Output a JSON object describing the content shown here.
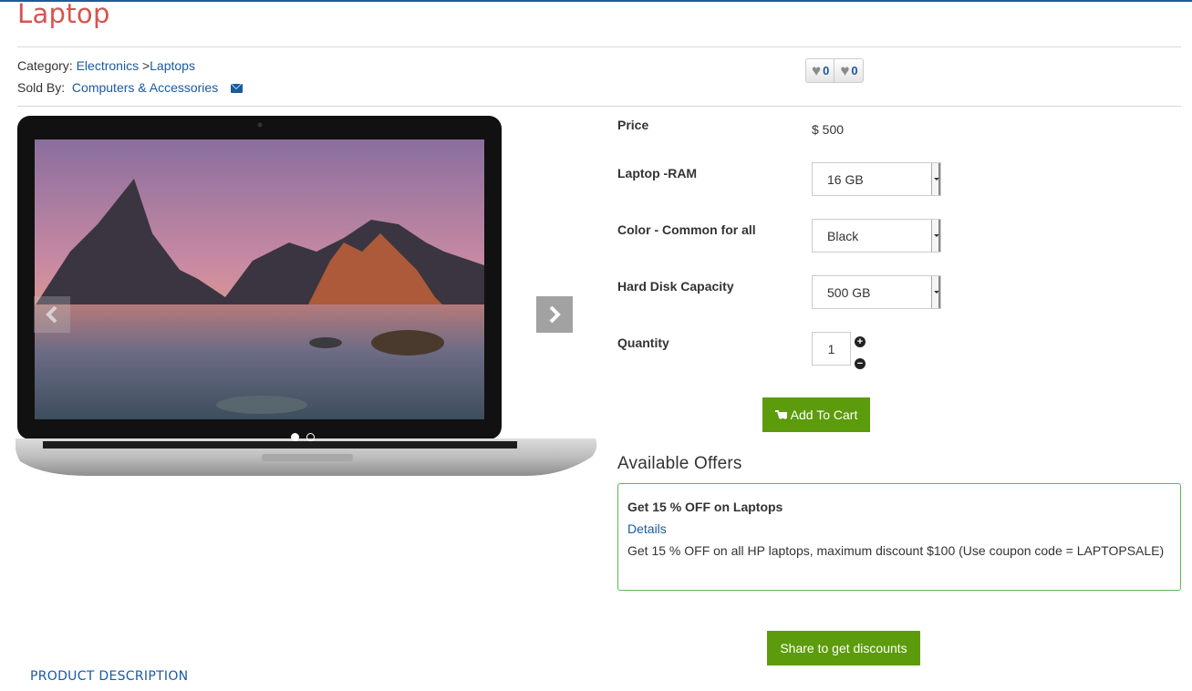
{
  "product": {
    "title": "Laptop"
  },
  "meta": {
    "category_label": "Category:",
    "category_parent": "Electronics",
    "separator": ">",
    "category_child": "Laptops",
    "sold_by_label": "Sold By:",
    "seller": "Computers & Accessories"
  },
  "reactions": {
    "likes": "0",
    "dislikes": "0"
  },
  "carousel": {
    "slides": 2,
    "active_slide": 1
  },
  "options": {
    "price_label": "Price",
    "price_value": "$ 500",
    "ram_label": "Laptop -RAM",
    "ram_value": "16 GB",
    "color_label": "Color - Common for all",
    "color_value": "Black",
    "hdd_label": "Hard Disk Capacity",
    "hdd_value": "500 GB",
    "quantity_label": "Quantity",
    "quantity_value": "1"
  },
  "actions": {
    "add_to_cart": "Add To Cart",
    "share": "Share to get discounts"
  },
  "offers": {
    "heading": "Available Offers",
    "title": "Get 15 % OFF on Laptops",
    "details_link": "Details",
    "description": "Get 15 % OFF on all HP laptops, maximum discount $100 (Use coupon code = LAPTOPSALE)"
  },
  "tabs": {
    "product_description": "PRODUCT DESCRIPTION"
  },
  "colors": {
    "title": "#d9534f",
    "link": "#1a5aa0",
    "button": "#5c9b0c",
    "offer_border": "#5cb85c"
  }
}
